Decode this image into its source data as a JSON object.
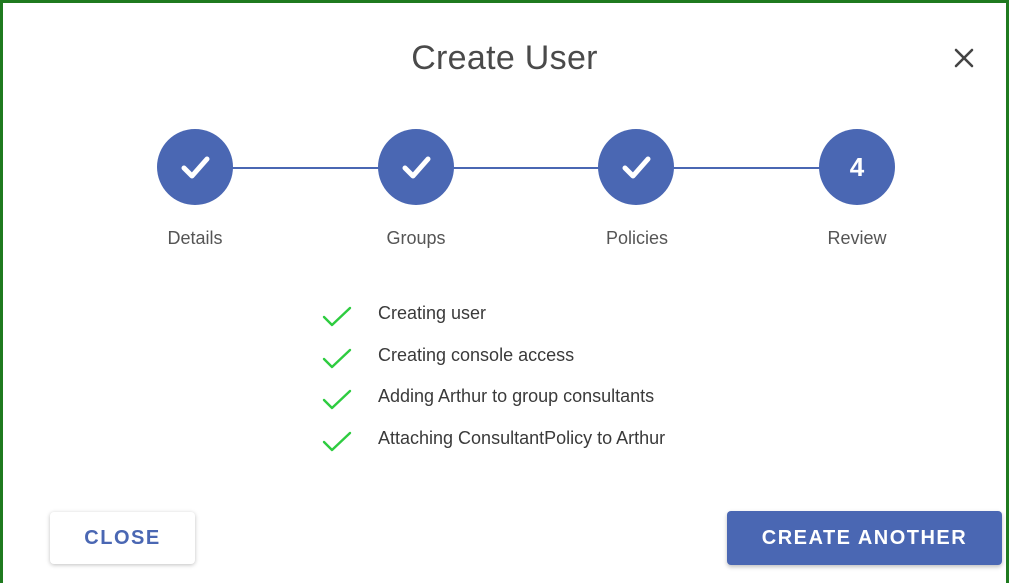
{
  "dialog": {
    "title": "Create User",
    "close_icon": "close-icon"
  },
  "stepper": {
    "accent_color": "#4a67b3",
    "steps": [
      {
        "label": "Details",
        "state": "completed",
        "icon": "check-icon"
      },
      {
        "label": "Groups",
        "state": "completed",
        "icon": "check-icon"
      },
      {
        "label": "Policies",
        "state": "completed",
        "icon": "check-icon"
      },
      {
        "label": "Review",
        "state": "active",
        "number": "4"
      }
    ]
  },
  "progress": {
    "success_color": "#2ecc40",
    "items": [
      {
        "text": "Creating user",
        "status": "done",
        "icon": "check-icon"
      },
      {
        "text": "Creating console access",
        "status": "done",
        "icon": "check-icon"
      },
      {
        "text": "Adding Arthur to group consultants",
        "status": "done",
        "icon": "check-icon"
      },
      {
        "text": "Attaching ConsultantPolicy to Arthur",
        "status": "done",
        "icon": "check-icon"
      }
    ]
  },
  "footer": {
    "close_label": "CLOSE",
    "create_another_label": "CREATE ANOTHER"
  }
}
